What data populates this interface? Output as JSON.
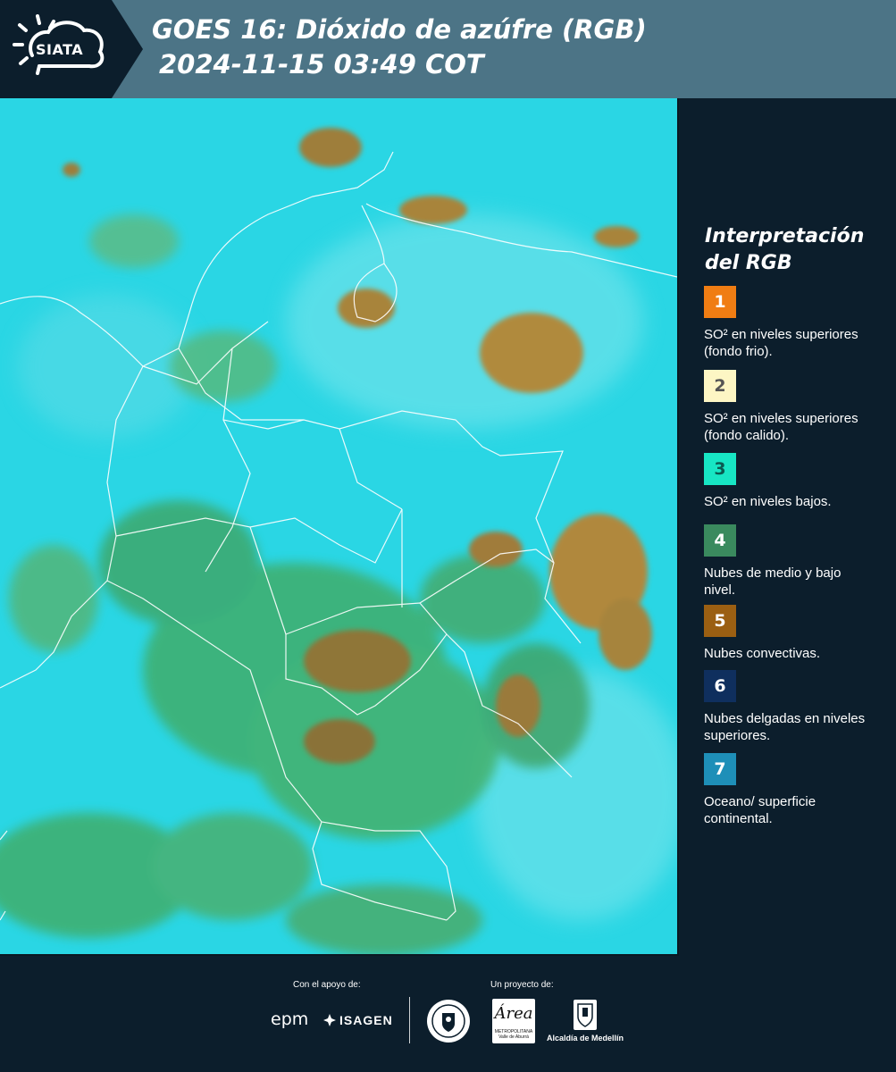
{
  "header": {
    "logo_text": "SIATA",
    "title_line1": "GOES 16: Dióxido de azúfre (RGB)",
    "title_line2": "2024-11-15 03:49 COT"
  },
  "legend": {
    "title_line1": "Interpretación",
    "title_line2": "del RGB",
    "items": [
      {
        "number": "1",
        "label": "SO² en niveles superiores (fondo frio).",
        "color": "#f07d13",
        "text_color": "#ffffff"
      },
      {
        "number": "2",
        "label": "SO² en niveles superiores (fondo calido).",
        "color": "#fdf6c4",
        "text_color": "#555555"
      },
      {
        "number": "3",
        "label": "SO² en niveles bajos.",
        "color": "#17e6c4",
        "text_color": "#0b5a50"
      },
      {
        "number": "4",
        "label": "Nubes de medio y bajo nivel.",
        "color": "#3a8a5e",
        "text_color": "#ffffff"
      },
      {
        "number": "5",
        "label": "Nubes convectivas.",
        "color": "#9b5f12",
        "text_color": "#ffffff"
      },
      {
        "number": "6",
        "label": "Nubes delgadas en niveles superiores.",
        "color": "#0f2f5e",
        "text_color": "#ffffff"
      },
      {
        "number": "7",
        "label": "Oceano/ superficie continental.",
        "color": "#1e8fb8",
        "text_color": "#ffffff"
      }
    ]
  },
  "footer": {
    "support_label": "Con el apoyo de:",
    "project_label": "Un proyecto de:",
    "epm": "epm",
    "isagen": "ISAGEN",
    "area_logo_text": "Área",
    "area_logo_sub": "METROPOLITANA Valle de Aburrá",
    "alcaldia": "Alcaldía de Medellín"
  },
  "colors": {
    "background": "#0c1e2c",
    "header": "#4c7486",
    "map_base": "#2ad6e4"
  }
}
